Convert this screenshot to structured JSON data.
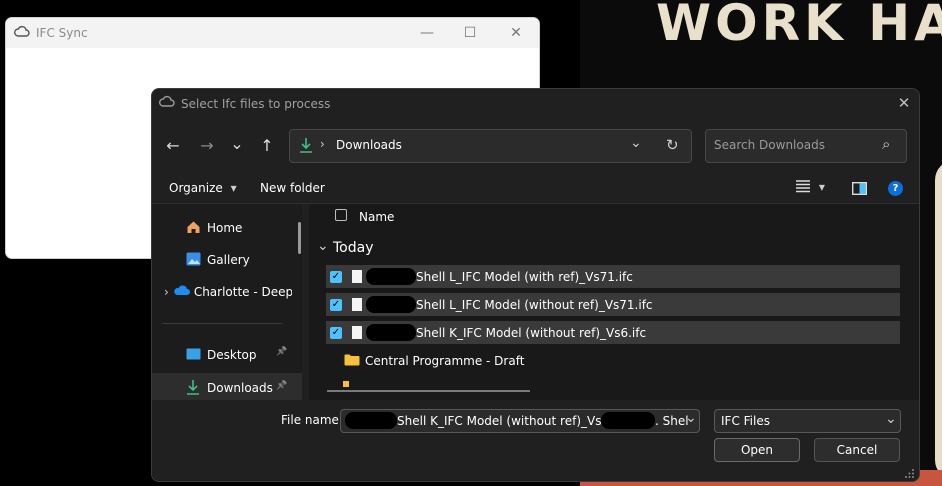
{
  "app_window": {
    "title": "IFC Sync",
    "minimize_glyph": "—",
    "maximize_glyph": "☐",
    "close_glyph": "✕"
  },
  "background_poster": {
    "text": "WORK HA"
  },
  "dialog": {
    "title": "Select Ifc files to process",
    "close_glyph": "✕",
    "nav": {
      "back": "←",
      "forward": "→",
      "dropdown": "⌄",
      "up": "↑"
    },
    "address": {
      "separator": "›",
      "location": "Downloads",
      "dropdown": "⌄",
      "refresh": "↻"
    },
    "search": {
      "placeholder": "Search Downloads",
      "icon": "⌕"
    },
    "commandbar": {
      "organize": "Organize",
      "organize_caret": "▾",
      "new_folder": "New folder",
      "view_caret": "▾",
      "help": "?"
    },
    "navpane": {
      "items": [
        {
          "label": "Home",
          "icon": "home-icon"
        },
        {
          "label": "Gallery",
          "icon": "gallery-icon"
        },
        {
          "label": "Charlotte - Deep",
          "icon": "onedrive-icon",
          "expander": "›"
        },
        {
          "label": "Desktop",
          "icon": "desktop-icon",
          "pin": "📌"
        },
        {
          "label": "Downloads",
          "icon": "downloads-icon",
          "pin": "📌"
        }
      ]
    },
    "filelist": {
      "column_name": "Name",
      "group_label": "Today",
      "group_caret": "⌄",
      "check_glyph": "✓",
      "rows": [
        {
          "name": "Shell L_IFC Model (with ref)_Vs71.ifc",
          "selected": true
        },
        {
          "name": "Shell L_IFC Model (without ref)_Vs71.ifc",
          "selected": true
        },
        {
          "name": "Shell K_IFC Model (without ref)_Vs6.ifc",
          "selected": true
        }
      ],
      "folder": {
        "name": "Central Programme - Draft"
      }
    },
    "footer": {
      "filename_label": "File name:",
      "filename_value_a": "Shell K_IFC Model (without ref)_Vs6.ifc\"",
      "filename_value_b": ". Shel",
      "filename_dropdown": "⌄",
      "filter_value": "IFC Files",
      "filter_dropdown": "⌄",
      "open_label": "Open",
      "cancel_label": "Cancel"
    }
  },
  "colors": {
    "accent": "#4cc2ff",
    "dialog_bg": "#202020",
    "selected_row": "#3a3a3a",
    "folder": "#f8c13b",
    "help": "#0a6fd8"
  }
}
